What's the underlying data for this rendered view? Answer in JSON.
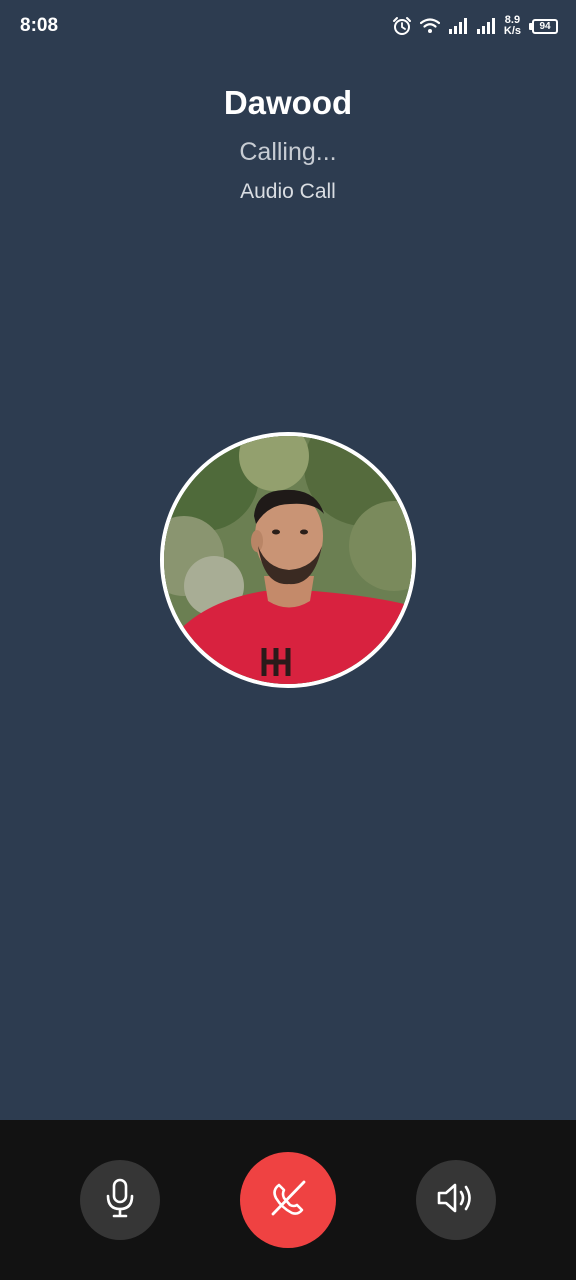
{
  "status_bar": {
    "time": "8:08",
    "icons": [
      "alarm-icon",
      "wifi-icon",
      "signal-icon",
      "signal-icon"
    ],
    "net_speed_value": "8.9",
    "net_speed_unit": "K/s",
    "battery_level": "94"
  },
  "call": {
    "caller_name": "Dawood",
    "status": "Calling...",
    "type": "Audio Call"
  },
  "controls": {
    "icons": [
      "microphone-icon",
      "end-call-icon",
      "speaker-icon"
    ]
  },
  "colors": {
    "background": "#2d3c50",
    "control_bar": "#121212",
    "end_call": "#ef4242",
    "control_button": "#363636"
  }
}
